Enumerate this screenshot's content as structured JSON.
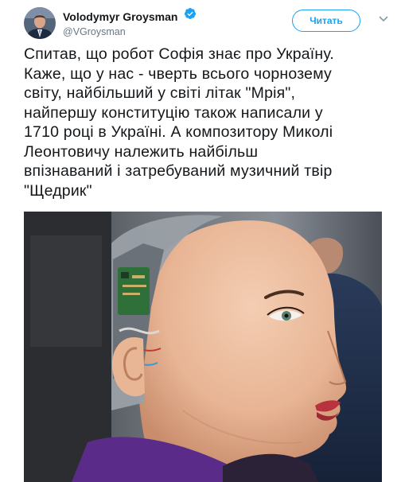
{
  "author": {
    "display_name": "Volodymyr Groysman",
    "handle": "@VGroysman",
    "verified": true
  },
  "follow_button": {
    "label": "Читать"
  },
  "tweet": {
    "lines": [
      "Спитав, що робот Софія знає про Україну.",
      "Каже, що у нас - чверть всього чорнозему",
      "світу, найбільший у світі літак \"Мрія\",",
      "найпершу конституцію також написали у",
      "1710 році в Україні. А композитору Миколі",
      "Леонтовичу належить найбільш",
      "впізнаваний і затребуваний музичний твір",
      "\"Щедрик\""
    ]
  },
  "icons": {
    "verified": "verified-badge-icon",
    "caret": "chevron-down-icon"
  },
  "colors": {
    "accent": "#1da1f2",
    "text": "#14171a",
    "secondary_text": "#657786"
  }
}
